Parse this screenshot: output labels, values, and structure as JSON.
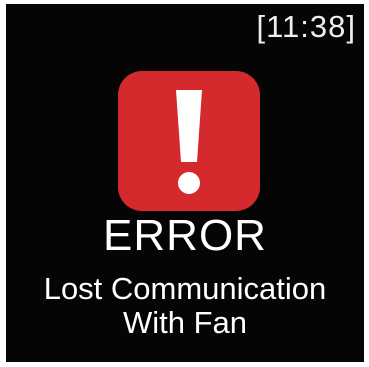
{
  "status_bar": {
    "time": "[11:38]"
  },
  "alert": {
    "icon": "exclamation-icon",
    "icon_color": "#d42a2e",
    "title": "ERROR",
    "message_line_1": "Lost Communication",
    "message_line_2": "With Fan"
  },
  "colors": {
    "background": "#050505",
    "text": "#ffffff"
  }
}
